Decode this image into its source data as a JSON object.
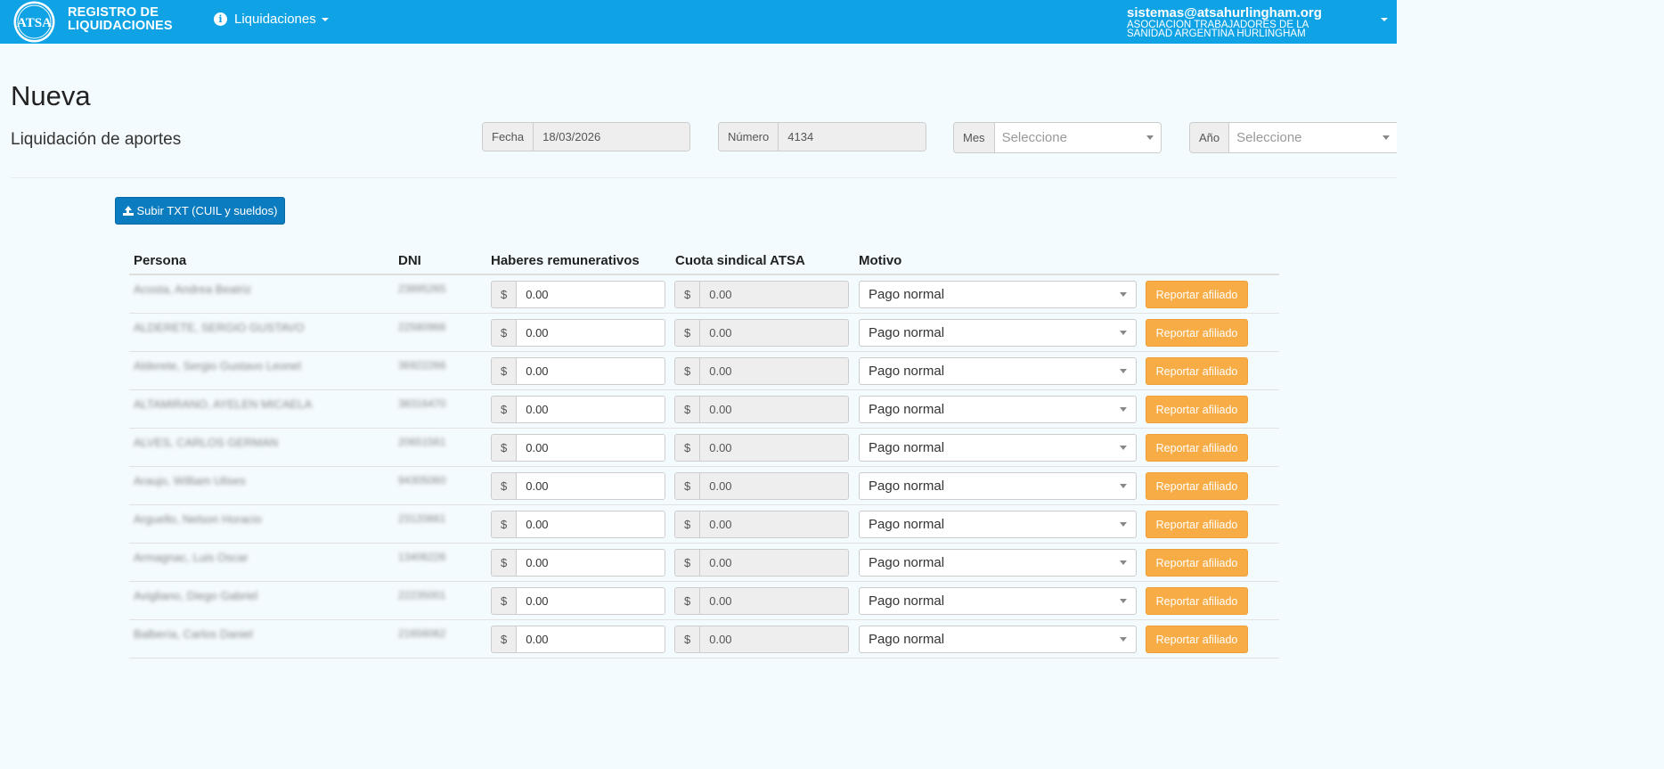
{
  "navbar": {
    "brand_line1": "REGISTRO DE",
    "brand_line2": "LIQUIDACIONES",
    "logo_text": "ATSA",
    "menu_label": "Liquidaciones",
    "user_email": "sistemas@atsahurlingham.org",
    "user_org_line1": "ASOCIACION TRABAJADORES DE LA",
    "user_org_line2": "SANIDAD ARGENTINA HURLINGHAM"
  },
  "header": {
    "title": "Nueva",
    "subtitle": "Liquidación de aportes"
  },
  "filters": {
    "fecha_label": "Fecha",
    "fecha_value": "18/03/2026",
    "numero_label": "Número",
    "numero_value": "4134",
    "mes_label": "Mes",
    "mes_value": "Seleccione",
    "anio_label": "Año",
    "anio_value": "Seleccione"
  },
  "upload_button": "Subir TXT (CUIL y sueldos)",
  "table": {
    "headers": {
      "persona": "Persona",
      "dni": "DNI",
      "haberes": "Haberes remunerativos",
      "cuota": "Cuota sindical ATSA",
      "motivo": "Motivo"
    },
    "currency": "$",
    "report_label": "Reportar afiliado",
    "rows": [
      {
        "persona": "Acosta, Andrea Beatriz",
        "dni": "23895265",
        "haberes": "0.00",
        "cuota": "0.00",
        "motivo": "Pago normal"
      },
      {
        "persona": "ALDERETE, SERGIO GUSTAVO",
        "dni": "22580966",
        "haberes": "0.00",
        "cuota": "0.00",
        "motivo": "Pago normal"
      },
      {
        "persona": "Alderete, Sergio Gustavo Leonel",
        "dni": "36922266",
        "haberes": "0.00",
        "cuota": "0.00",
        "motivo": "Pago normal"
      },
      {
        "persona": "ALTAMIRANO, AYELEN MICAELA",
        "dni": "38316470",
        "haberes": "0.00",
        "cuota": "0.00",
        "motivo": "Pago normal"
      },
      {
        "persona": "ALVES, CARLOS GERMAN",
        "dni": "20651561",
        "haberes": "0.00",
        "cuota": "0.00",
        "motivo": "Pago normal"
      },
      {
        "persona": "Araujo, William Ulises",
        "dni": "94305060",
        "haberes": "0.00",
        "cuota": "0.00",
        "motivo": "Pago normal"
      },
      {
        "persona": "Arguello, Nelson Horacio",
        "dni": "23120661",
        "haberes": "0.00",
        "cuota": "0.00",
        "motivo": "Pago normal"
      },
      {
        "persona": "Armagnac, Luis Oscar",
        "dni": "13406226",
        "haberes": "0.00",
        "cuota": "0.00",
        "motivo": "Pago normal"
      },
      {
        "persona": "Avigliano, Diego Gabriel",
        "dni": "22235001",
        "haberes": "0.00",
        "cuota": "0.00",
        "motivo": "Pago normal"
      },
      {
        "persona": "Balbería, Carlos Daniel",
        "dni": "21656062",
        "haberes": "0.00",
        "cuota": "0.00",
        "motivo": "Pago normal"
      }
    ]
  },
  "colors": {
    "navbar": "#0fa3e6",
    "primary_button": "#0a7cbf",
    "warning_button": "#f8ac45",
    "page_bg": "#f4fbfe"
  }
}
